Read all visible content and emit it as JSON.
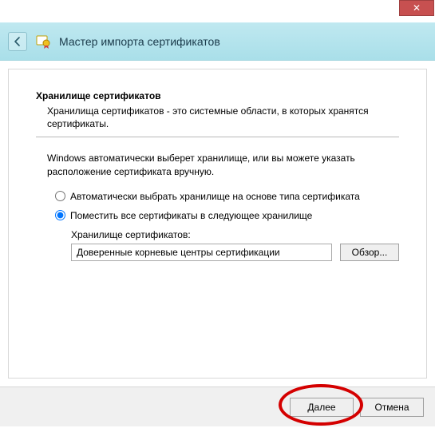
{
  "titlebar": {
    "close_glyph": "✕"
  },
  "header": {
    "title": "Мастер импорта сертификатов"
  },
  "section": {
    "title": "Хранилище сертификатов",
    "description": "Хранилища сертификатов - это системные области, в которых хранятся сертификаты."
  },
  "instruction": "Windows автоматически выберет хранилище, или вы можете указать расположение сертификата вручную.",
  "radios": {
    "auto": "Автоматически выбрать хранилище на основе типа сертификата",
    "custom": "Поместить все сертификаты в следующее хранилище",
    "selected": "custom"
  },
  "store": {
    "label": "Хранилище сертификатов:",
    "value": "Доверенные корневые центры сертификации",
    "browse": "Обзор..."
  },
  "footer": {
    "next": "Далее",
    "cancel": "Отмена"
  }
}
